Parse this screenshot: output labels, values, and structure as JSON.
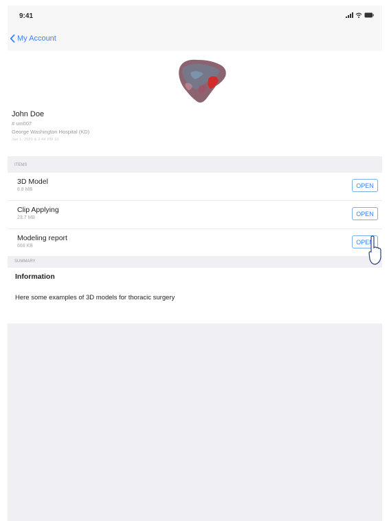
{
  "status_bar": {
    "time": "9:41",
    "icons": [
      "signal-icon",
      "wifi-icon",
      "battery-icon"
    ]
  },
  "nav": {
    "back_label": "My Account",
    "back_icon": "chevron-left-icon"
  },
  "patient": {
    "name": "John Doe",
    "id": "# um007",
    "hospital": "George Washington Hospital (KD)",
    "extra": "Jan 1, 2020 & 2:44 PM 10"
  },
  "sections": {
    "items_header": "ITEMS",
    "summary_header": "SUMMARY"
  },
  "items": [
    {
      "name": "3D Model",
      "size": "8.8 MB",
      "button": "OPEN"
    },
    {
      "name": "Clip Applying",
      "size": "23.7 MB",
      "button": "OPEN"
    },
    {
      "name": "Modeling report",
      "size": "668 KB",
      "button": "OPEN"
    }
  ],
  "summary": {
    "title": "Information",
    "text": "Here some examples of 3D models for thoracic surgery"
  },
  "colors": {
    "accent": "#3b82f6",
    "section_bg": "#efeff4",
    "nav_bg": "#f7f7f8"
  }
}
